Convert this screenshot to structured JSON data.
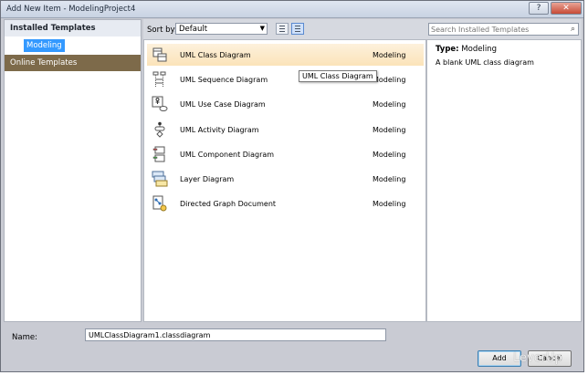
{
  "window": {
    "title": "Add New Item - ModelingProject4"
  },
  "left_pane": {
    "installed_header": "Installed Templates",
    "selected_item": "Modeling",
    "online_header": "Online Templates"
  },
  "toolbar": {
    "sort_label": "Sort by:",
    "sort_value": "Default",
    "search_placeholder": "Search Installed Templates"
  },
  "templates": [
    {
      "name": "UML Class Diagram",
      "type": "Modeling",
      "icon": "class-diagram-icon"
    },
    {
      "name": "UML Sequence Diagram",
      "type": "Modeling",
      "icon": "sequence-diagram-icon"
    },
    {
      "name": "UML Use Case Diagram",
      "type": "Modeling",
      "icon": "use-case-diagram-icon"
    },
    {
      "name": "UML Activity Diagram",
      "type": "Modeling",
      "icon": "activity-diagram-icon"
    },
    {
      "name": "UML Component Diagram",
      "type": "Modeling",
      "icon": "component-diagram-icon"
    },
    {
      "name": "Layer Diagram",
      "type": "Modeling",
      "icon": "layer-diagram-icon"
    },
    {
      "name": "Directed Graph Document",
      "type": "Modeling",
      "icon": "directed-graph-icon"
    }
  ],
  "tooltip": "UML Class Diagram",
  "details": {
    "type_label": "Type:",
    "type_value": "Modeling",
    "description": "A blank UML class diagram"
  },
  "name_field": {
    "label": "Name:",
    "value": "UMLClassDiagram1.classdiagram"
  },
  "buttons": {
    "add": "Add",
    "cancel": "Cancel"
  },
  "watermark": "LeverUp"
}
